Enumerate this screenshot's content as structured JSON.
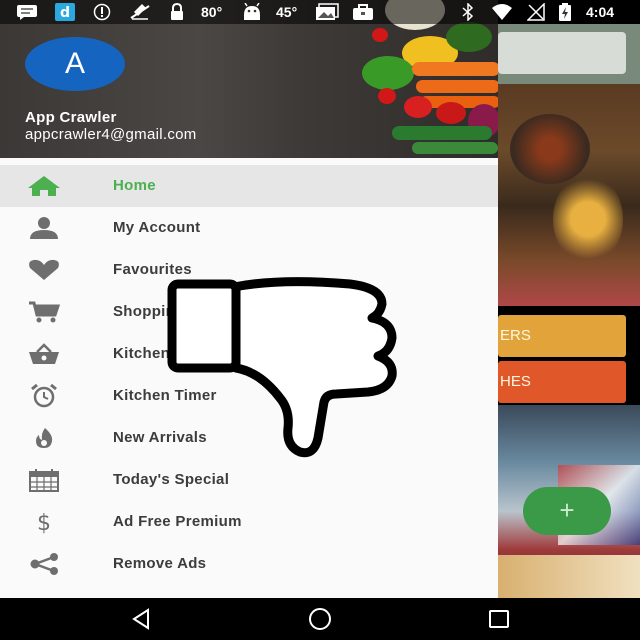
{
  "status_bar": {
    "temp1": "80°",
    "temp2": "45°",
    "time": "4:04",
    "icons": [
      "message-icon",
      "app-d-icon",
      "info-icon",
      "no-location-icon",
      "lock-icon",
      "android-icon",
      "photo-icon",
      "briefcase-icon",
      "bluetooth-icon",
      "wifi-icon",
      "no-sim-icon",
      "battery-charging-icon"
    ]
  },
  "drawer": {
    "avatar_letter": "A",
    "account_name": "App Crawler",
    "account_email": "appcrawler4@gmail.com",
    "items": [
      {
        "label": "Home",
        "icon": "home-icon",
        "active": true
      },
      {
        "label": "My Account",
        "icon": "person-icon",
        "active": false
      },
      {
        "label": "Favourites",
        "icon": "heart-icon",
        "active": false
      },
      {
        "label": "Shopping List",
        "icon": "cart-icon",
        "active": false
      },
      {
        "label": "Kitchen Store",
        "icon": "basket-icon",
        "active": false
      },
      {
        "label": "Kitchen Timer",
        "icon": "alarm-clock-icon",
        "active": false
      },
      {
        "label": "New Arrivals",
        "icon": "flame-icon",
        "active": false
      },
      {
        "label": "Today's Special",
        "icon": "calendar-icon",
        "active": false
      },
      {
        "label": "Ad Free Premium",
        "icon": "dollar-icon",
        "active": false
      },
      {
        "label": "Remove Ads",
        "icon": "share-icon",
        "active": false
      }
    ]
  },
  "background": {
    "button1_label": "ERS",
    "button2_label": "HES",
    "fab_label": "+"
  },
  "colors": {
    "accent_green": "#4caf50",
    "avatar_blue": "#1565c0",
    "orange": "#e2a33a",
    "deep_orange": "#e0572a"
  }
}
